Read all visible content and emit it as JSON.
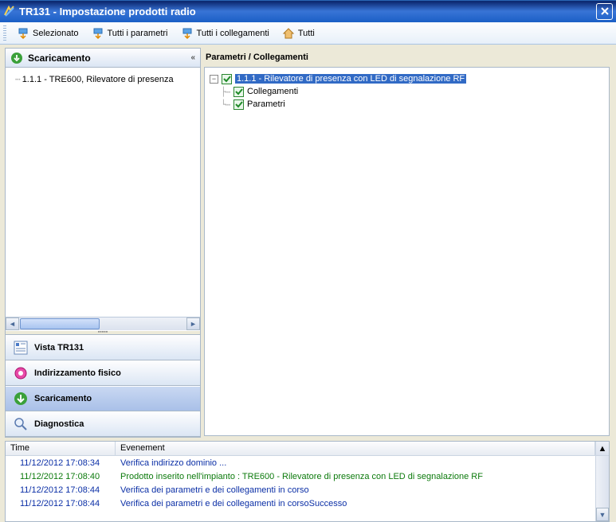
{
  "window": {
    "title": "TR131 - Impostazione prodotti radio"
  },
  "toolbar": {
    "selezionato": "Selezionato",
    "tutti_parametri": "Tutti i parametri",
    "tutti_collegamenti": "Tutti i collegamenti",
    "tutti": "Tutti"
  },
  "sidebar": {
    "header": "Scaricamento",
    "collapse_symbol": "«",
    "tree_item": "1.1.1 - TRE600, Rilevatore di presenza",
    "nav": {
      "vista": "Vista TR131",
      "indirizzamento": "Indirizzamento fisico",
      "scaricamento": "Scaricamento",
      "diagnostica": "Diagnostica"
    }
  },
  "right": {
    "title": "Parametri / Collegamenti",
    "node_main": "1.1.1 - Rilevatore di presenza con LED di segnalazione RF",
    "node_collegamenti": "Collegamenti",
    "node_parametri": "Parametri"
  },
  "log": {
    "col_time": "Time",
    "col_event": "Evenement",
    "rows": [
      {
        "time": "11/12/2012 17:08:34",
        "event": "Verifica indirizzo dominio ...",
        "color": "blue"
      },
      {
        "time": "11/12/2012 17:08:40",
        "event": "Prodotto inserito nell'impianto : TRE600 - Rilevatore di presenza con LED di segnalazione RF",
        "color": "green"
      },
      {
        "time": "11/12/2012 17:08:44",
        "event": "Verifica dei parametri e dei collegamenti in corso",
        "color": "blue"
      },
      {
        "time": "11/12/2012 17:08:44",
        "event": "Verifica dei parametri e dei collegamenti in corsoSuccesso",
        "color": "blue"
      }
    ]
  }
}
